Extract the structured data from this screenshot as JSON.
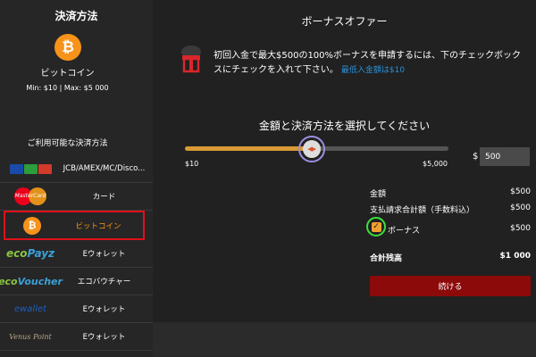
{
  "sidebar": {
    "title": "決済方法",
    "selected_icon": "bitcoin-icon",
    "selected_name": "ビットコイン",
    "limits": "Min: $10 | Max: $5 000",
    "available_title": "ご利用可能な決済方法",
    "methods": [
      {
        "label": "JCB/AMEX/MC/Disco...",
        "icon": "cards-icon"
      },
      {
        "label": "カード",
        "icon": "mastercard-icon",
        "logo_text": "MasterCard"
      },
      {
        "label": "ビットコイン",
        "icon": "bitcoin-icon"
      },
      {
        "label": "Eウォレット",
        "icon": "ecopayz-icon",
        "logo_text_a": "eco",
        "logo_text_b": "Payz"
      },
      {
        "label": "エコバウチャー",
        "icon": "ecovoucher-icon",
        "logo_text_a": "eco",
        "logo_text_b": "Voucher"
      },
      {
        "label": "Eウォレット",
        "icon": "wallet-blue-icon",
        "logo_text": "ewallet"
      },
      {
        "label": "Eウォレット",
        "icon": "venuspoint-icon",
        "logo_text": "Venus Point"
      }
    ]
  },
  "main": {
    "title": "ボーナスオファー",
    "offer_text": "初回入金で最大$500の100%ボーナスを申請するには、下のチェックボックスにチェックを入れて下さい。",
    "min_deposit": "最低入金額は$10",
    "select_title": "金額と決済方法を選択してください",
    "slider": {
      "min_label": "$10",
      "max_label": "$5,000",
      "value_fraction": 0.48
    },
    "currency": "$",
    "amount": "500",
    "summary": {
      "amount_label": "金額",
      "amount_value": "$500",
      "total_label": "支払請求合計額（手数料込）",
      "total_value": "$500",
      "bonus_label": "ボーナス",
      "bonus_value": "$500",
      "balance_label": "合計残高",
      "balance_value": "$1 000"
    },
    "continue_label": "続ける"
  },
  "colors": {
    "accent": "#f7931a",
    "selection_border": "#e0101a",
    "button": "#8c0a0a",
    "link": "#2b8fd6"
  }
}
